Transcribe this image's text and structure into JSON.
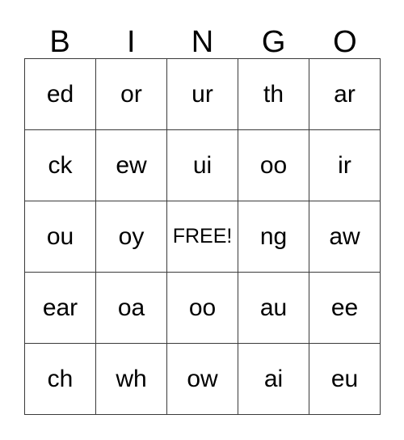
{
  "card": {
    "title": "BINGO",
    "headers": [
      "B",
      "I",
      "N",
      "G",
      "O"
    ],
    "free_space_label": "FREE!",
    "free_space_position": {
      "row": 2,
      "col": 2
    },
    "colors": {
      "background": "#ffffff",
      "border": "#3a3a3a",
      "text": "#000000"
    },
    "rows": [
      {
        "cells": [
          {
            "value": "ed",
            "free": false
          },
          {
            "value": "or",
            "free": false
          },
          {
            "value": "ur",
            "free": false
          },
          {
            "value": "th",
            "free": false
          },
          {
            "value": "ar",
            "free": false
          }
        ]
      },
      {
        "cells": [
          {
            "value": "ck",
            "free": false
          },
          {
            "value": "ew",
            "free": false
          },
          {
            "value": "ui",
            "free": false
          },
          {
            "value": "oo",
            "free": false
          },
          {
            "value": "ir",
            "free": false
          }
        ]
      },
      {
        "cells": [
          {
            "value": "ou",
            "free": false
          },
          {
            "value": "oy",
            "free": false
          },
          {
            "value": "FREE!",
            "free": true
          },
          {
            "value": "ng",
            "free": false
          },
          {
            "value": "aw",
            "free": false
          }
        ]
      },
      {
        "cells": [
          {
            "value": "ear",
            "free": false
          },
          {
            "value": "oa",
            "free": false
          },
          {
            "value": "oo",
            "free": false
          },
          {
            "value": "au",
            "free": false
          },
          {
            "value": "ee",
            "free": false
          }
        ]
      },
      {
        "cells": [
          {
            "value": "ch",
            "free": false
          },
          {
            "value": "wh",
            "free": false
          },
          {
            "value": "ow",
            "free": false
          },
          {
            "value": "ai",
            "free": false
          },
          {
            "value": "eu",
            "free": false
          }
        ]
      }
    ]
  }
}
